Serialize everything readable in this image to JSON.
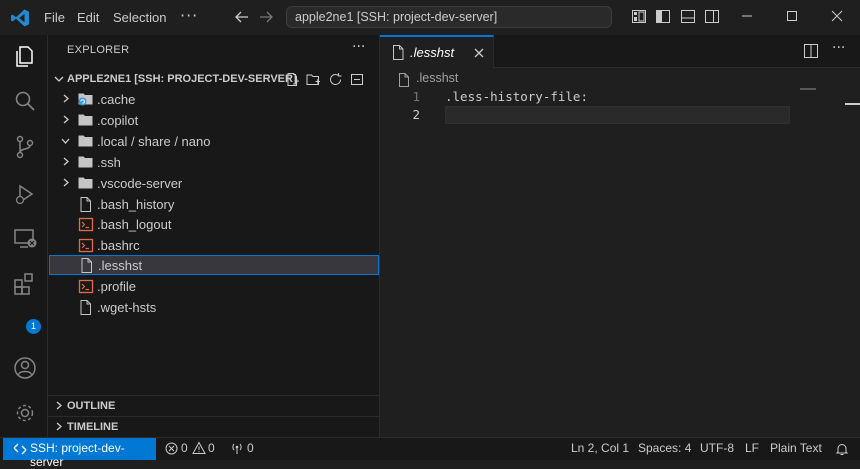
{
  "titlebar": {
    "menu": [
      "File",
      "Edit",
      "Selection"
    ],
    "command_center": "apple2ne1 [SSH: project-dev-server]"
  },
  "activity_bar": {
    "items": [
      "explorer-icon",
      "search-icon",
      "source-control-icon",
      "run-debug-icon",
      "remote-explorer-icon",
      "extensions-icon",
      "account-icon",
      "settings-gear-icon"
    ],
    "extensions_badge": "1"
  },
  "sidebar": {
    "title": "EXPLORER",
    "root_label": "APPLE2NE1 [SSH: PROJECT-DEV-SERVER]",
    "items": [
      {
        "label": ".cache",
        "type": "folder"
      },
      {
        "label": ".copilot",
        "type": "folder"
      },
      {
        "label": ".local / share / nano",
        "type": "folder",
        "expanded": true
      },
      {
        "label": ".ssh",
        "type": "folder"
      },
      {
        "label": ".vscode-server",
        "type": "folder"
      },
      {
        "label": ".bash_history",
        "type": "file"
      },
      {
        "label": ".bash_logout",
        "type": "shell"
      },
      {
        "label": ".bashrc",
        "type": "shell"
      },
      {
        "label": ".lesshst",
        "type": "file",
        "selected": true
      },
      {
        "label": ".profile",
        "type": "shell"
      },
      {
        "label": ".wget-hsts",
        "type": "file"
      }
    ],
    "sections": [
      "OUTLINE",
      "TIMELINE"
    ]
  },
  "editor": {
    "tab_label": ".lesshst",
    "breadcrumb": ".lesshst",
    "lines": [
      {
        "number": "1",
        "text": ".less-history-file:"
      },
      {
        "number": "2",
        "text": ""
      }
    ]
  },
  "statusbar": {
    "remote": "SSH: project-dev-server",
    "errors": "0",
    "warnings": "0",
    "ports": "0",
    "position": "Ln 2, Col 1",
    "spaces": "Spaces: 4",
    "encoding": "UTF-8",
    "eol": "LF",
    "language": "Plain Text"
  },
  "colors": {
    "accent": "#0078d4",
    "background": "#1f1f1f",
    "sidebar": "#181818",
    "shell_file": "#e06c4b",
    "cache_badge": "#3a96dd"
  }
}
